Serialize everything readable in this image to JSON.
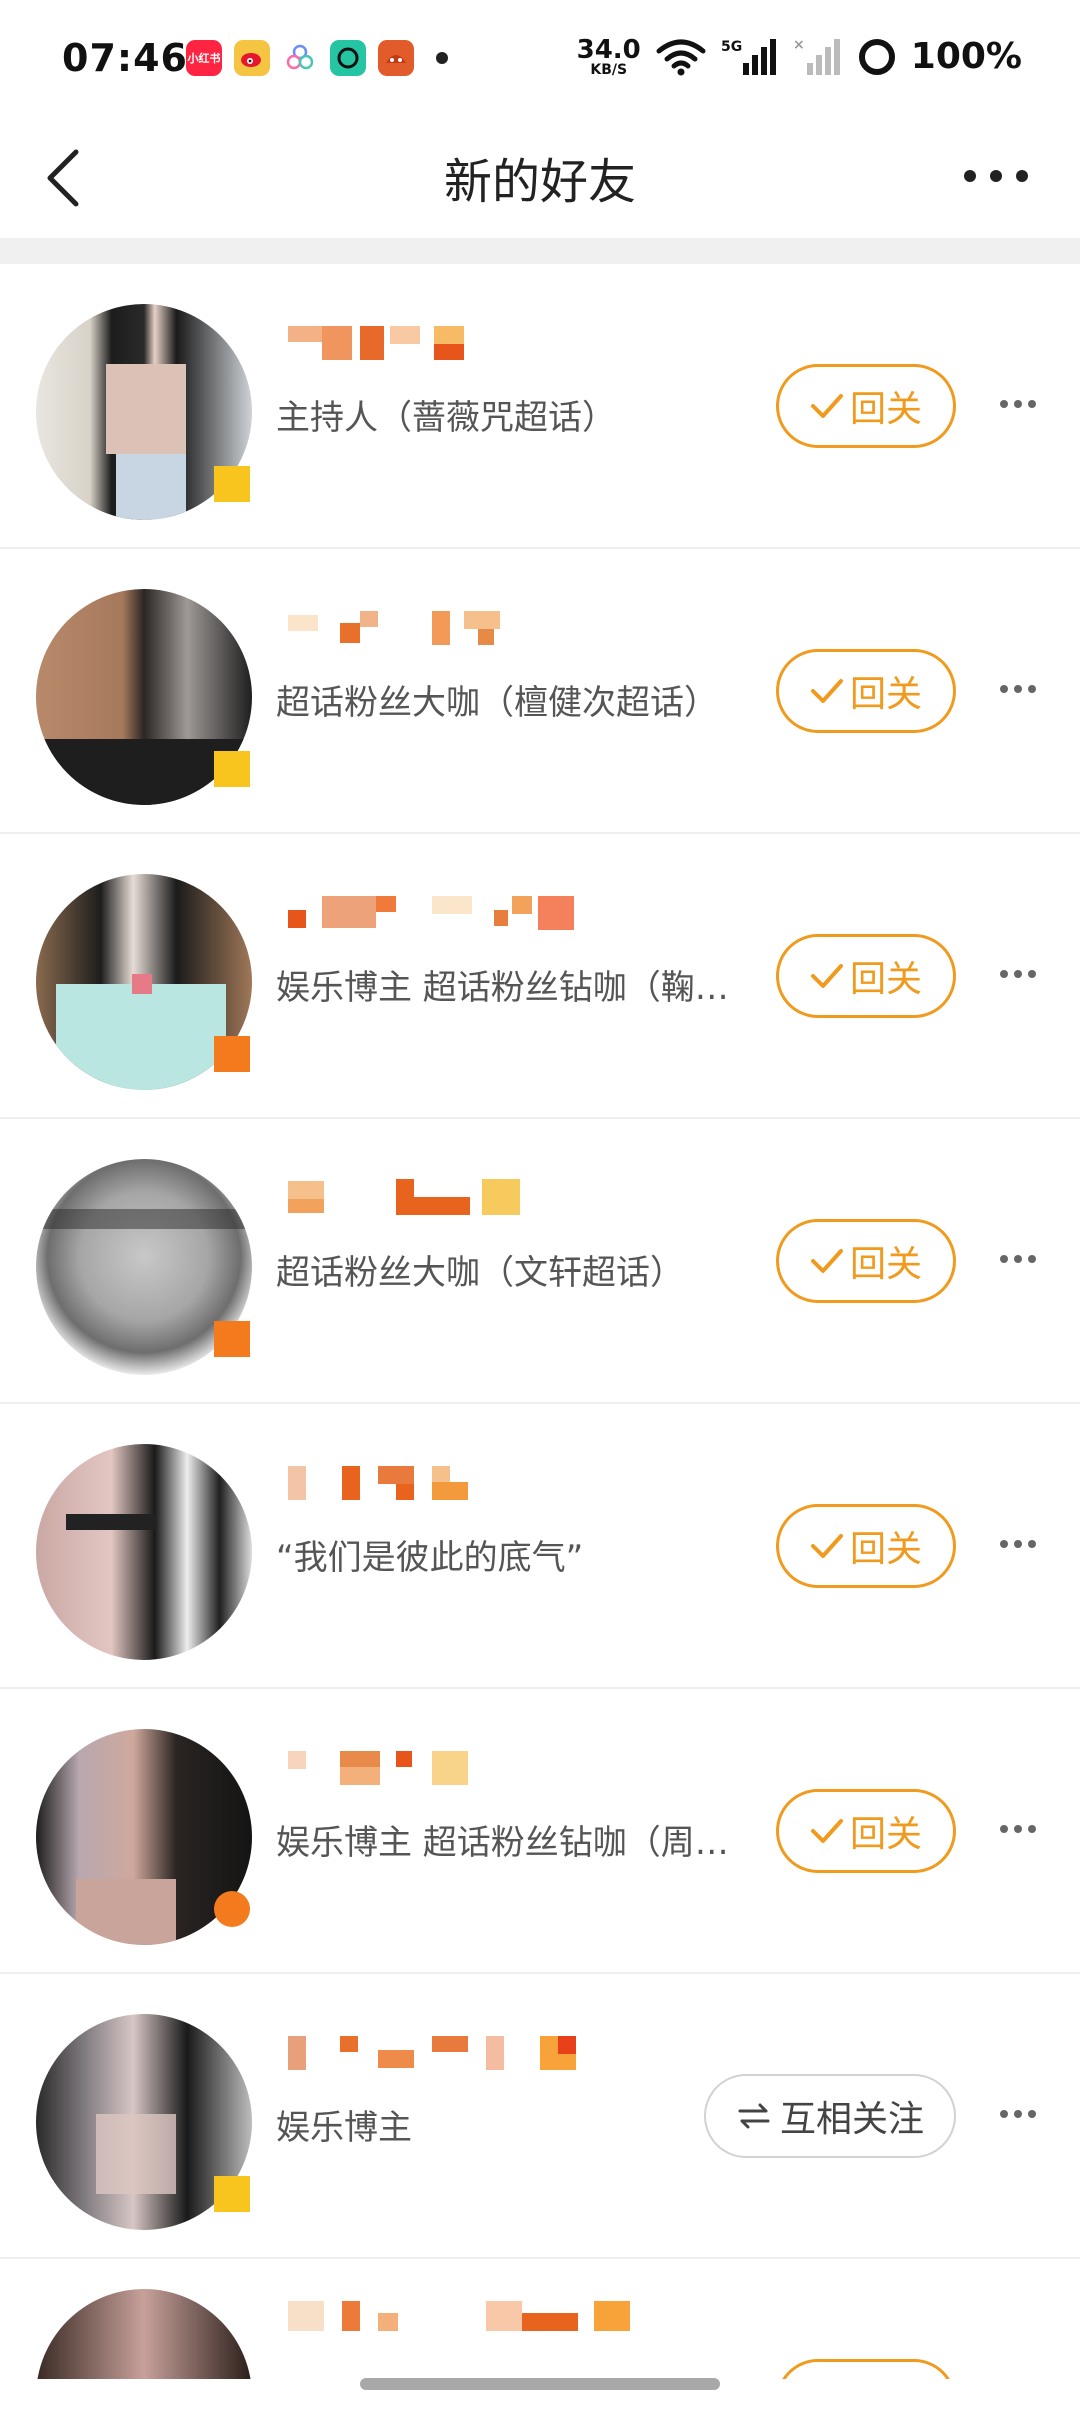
{
  "status_bar": {
    "time": "07:46",
    "app_icon_label": "小红书",
    "net_speed_value": "34.0",
    "net_speed_unit": "KB/S",
    "network_label": "5G",
    "battery": "100%"
  },
  "header": {
    "title": "新的好友"
  },
  "colors": {
    "accent": "#f09a1e",
    "mutual_border": "#d2d2d2",
    "separator": "#efefef"
  },
  "friends": [
    {
      "desc": "主持人（蔷薇咒超话）",
      "action": "回关",
      "action_type": "follow_back"
    },
    {
      "desc": "超话粉丝大咖（檀健次超话）",
      "action": "回关",
      "action_type": "follow_back"
    },
    {
      "desc": "娱乐博主 超话粉丝钻咖（鞠…",
      "action": "回关",
      "action_type": "follow_back"
    },
    {
      "desc": "超话粉丝大咖（文轩超话）",
      "action": "回关",
      "action_type": "follow_back"
    },
    {
      "desc": "“我们是彼此的底气”",
      "action": "回关",
      "action_type": "follow_back"
    },
    {
      "desc": "娱乐博主 超话粉丝钻咖（周…",
      "action": "回关",
      "action_type": "follow_back"
    },
    {
      "desc": "娱乐博主",
      "action": "互相关注",
      "action_type": "mutual"
    },
    {
      "desc": "",
      "action": "",
      "action_type": "follow_back"
    }
  ]
}
